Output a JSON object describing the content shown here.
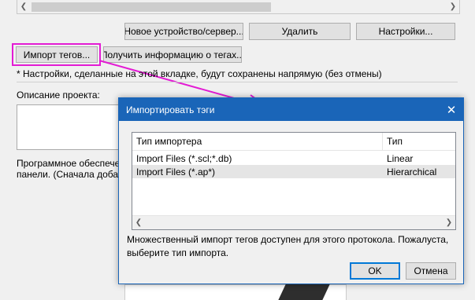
{
  "main": {
    "buttons": {
      "new_device": "Новое устройство/сервер...",
      "delete": "Удалить",
      "settings": "Настройки...",
      "import_tags": "Импорт тегов...",
      "get_tag_info": "Получить информацию о тегах..."
    },
    "note": "* Настройки, сделанные на этой вкладке, будут сохранены напрямую (без отмены)",
    "project_description_label": "Описание проекта:",
    "software_line1": "Программное обеспече",
    "software_line2": "панели. (Сначала добавь"
  },
  "dialog": {
    "title": "Импортировать тэги",
    "columns": [
      "Тип импортера",
      "Тип"
    ],
    "rows": [
      {
        "importer": "Import Files (*.scl;*.db)",
        "type": "Linear"
      },
      {
        "importer": "Import Files (*.ap*)",
        "type": "Hierarchical"
      }
    ],
    "message": "Множественный импорт тегов доступен для этого протокола. Пожалуста, выберите тип импорта.",
    "ok_label": "OK",
    "cancel_label": "Отмена"
  },
  "annotation": {
    "color": "#e31bd4"
  },
  "colors": {
    "accent": "#1a65b8"
  }
}
